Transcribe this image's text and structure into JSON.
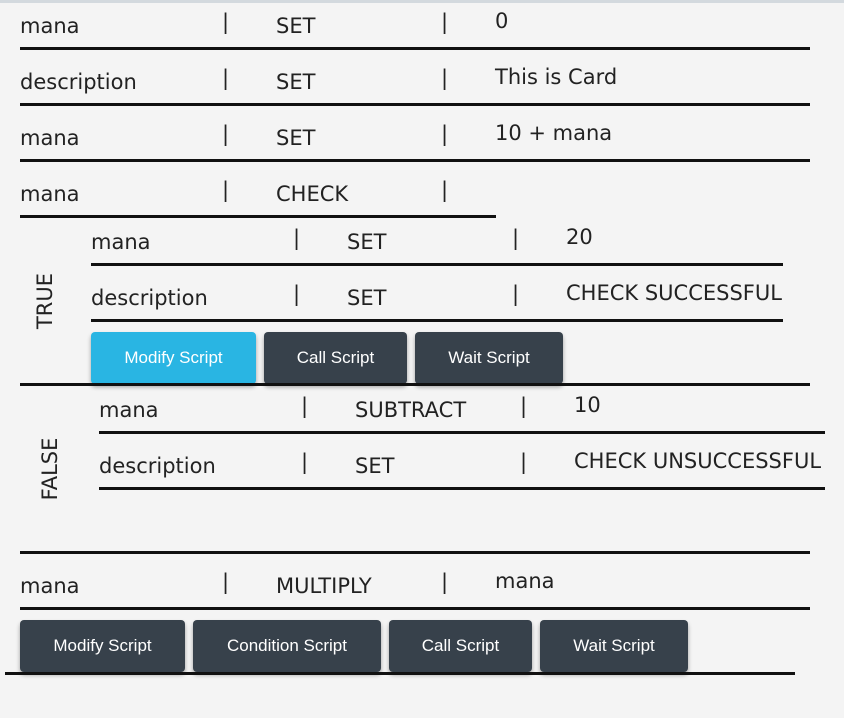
{
  "rows": [
    {
      "field": "mana",
      "op": "SET",
      "value": "0"
    },
    {
      "field": "description",
      "op": "SET",
      "value": "This is Card"
    },
    {
      "field": "mana",
      "op": "SET",
      "value": "10 + mana"
    },
    {
      "field": "mana",
      "op": "CHECK",
      "value": ""
    },
    {
      "field": "mana",
      "op": "MULTIPLY",
      "value": "mana"
    }
  ],
  "separator": "|",
  "true_branch": {
    "label": "TRUE",
    "rows": [
      {
        "field": "mana",
        "op": "SET",
        "value": "20"
      },
      {
        "field": "description",
        "op": "SET",
        "value": "CHECK SUCCESSFUL"
      }
    ],
    "buttons": {
      "modify": "Modify Script",
      "call": "Call Script",
      "wait": "Wait Script"
    }
  },
  "false_branch": {
    "label": "FALSE",
    "rows": [
      {
        "field": "mana",
        "op": "SUBTRACT",
        "value": "10"
      },
      {
        "field": "description",
        "op": "SET",
        "value": "CHECK UNSUCCESSFUL"
      }
    ]
  },
  "bottom_buttons": {
    "modify": "Modify Script",
    "condition": "Condition Script",
    "call": "Call Script",
    "wait": "Wait Script"
  },
  "colors": {
    "active_button": "#29b5e3",
    "button": "#37414b",
    "background": "#f4f4f4"
  }
}
